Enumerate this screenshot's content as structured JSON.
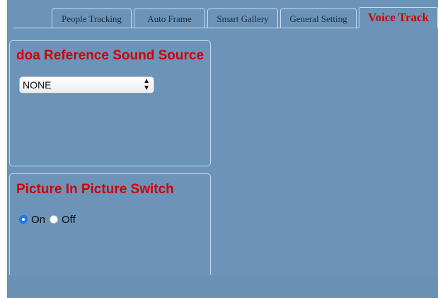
{
  "tabs": [
    {
      "label": "People Tracking",
      "active": false
    },
    {
      "label": "Auto Frame",
      "active": false
    },
    {
      "label": "Smart Gallery",
      "active": false
    },
    {
      "label": "General Setting",
      "active": false
    },
    {
      "label": "Voice Track",
      "active": true
    }
  ],
  "doa_panel": {
    "title": "doa Reference Sound Source",
    "select_value": "NONE"
  },
  "pip_panel": {
    "title": "Picture In Picture Switch",
    "options": [
      {
        "label": "On",
        "checked": true
      },
      {
        "label": "Off",
        "checked": false
      }
    ]
  },
  "colors": {
    "background": "#6b94b8",
    "accent_title": "#d40000",
    "border": "#c9dced",
    "radio_checked": "#1f7ef5"
  }
}
